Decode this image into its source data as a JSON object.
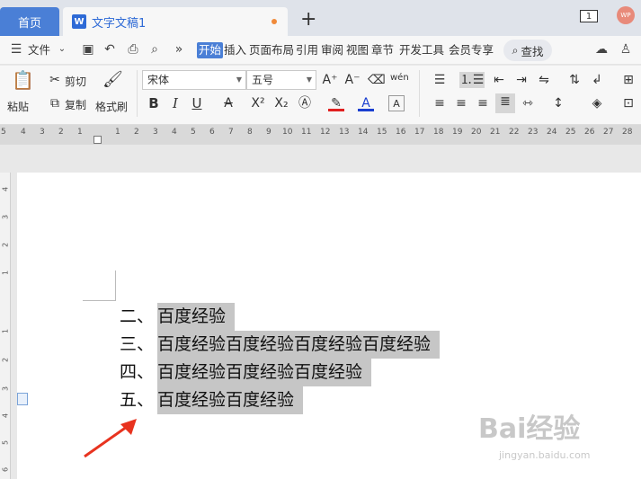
{
  "titlebar": {
    "home_tab": "首页",
    "doc_tab": "文字文稿1",
    "doc_icon": "W",
    "new_tab": "+",
    "window_count": "1",
    "avatar_text": "WP"
  },
  "menubar": {
    "file_label": "文件",
    "more": "»",
    "items": [
      "开始",
      "插入",
      "页面布局",
      "引用",
      "审阅",
      "视图",
      "章节",
      "开发工具",
      "会员专享"
    ],
    "search_label": "查找"
  },
  "ribbon": {
    "paste_label": "粘贴",
    "cut_label": "剪切",
    "copy_label": "复制",
    "format_painter_label": "格式刷",
    "font_name": "宋体",
    "font_size": "五号",
    "bold": "B",
    "italic": "I",
    "underline": "U"
  },
  "ruler": {
    "ticks": [
      "5",
      "4",
      "3",
      "2",
      "1",
      "",
      "2",
      "4",
      "6",
      "8",
      "10",
      "12",
      "14",
      "16",
      "18",
      "20",
      "22",
      "24",
      "26",
      "28",
      "30",
      "32",
      "34",
      "36",
      "38",
      "40",
      "42",
      "44",
      "46"
    ],
    "labels": [
      "5",
      "4",
      "3",
      "2",
      "1",
      "",
      "1",
      "2",
      "3",
      "4",
      "5",
      "6",
      "7",
      "8",
      "9",
      "10",
      "11",
      "12",
      "13",
      "14",
      "15",
      "16",
      "17",
      "18",
      "19",
      "20",
      "21",
      "22",
      "23",
      "24",
      "25",
      "26",
      "27",
      "28"
    ]
  },
  "document": {
    "lines": [
      {
        "num": "二、",
        "text": "百度经验"
      },
      {
        "num": "三、",
        "text": "百度经验百度经验百度经验百度经验"
      },
      {
        "num": "四、",
        "text": "百度经验百度经验百度经验"
      },
      {
        "num": "五、",
        "text": "百度经验百度经验"
      }
    ]
  },
  "watermark": {
    "main": "Bai经验",
    "sub": "jingyan.baidu.com"
  },
  "colors": {
    "accent": "#4a7fd6",
    "highlight": "#c6c6c6",
    "arrow": "#e8331f"
  }
}
